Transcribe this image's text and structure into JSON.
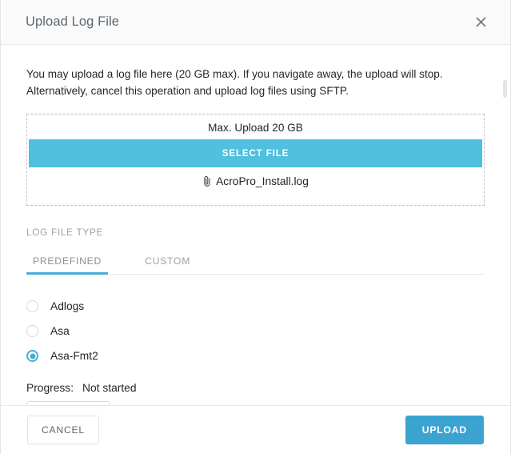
{
  "dialog": {
    "title": "Upload Log File",
    "close_icon": "close-icon"
  },
  "intro": {
    "line1": "You may upload a log file here (20 GB max). If you navigate away, the upload will stop.",
    "line2": "Alternatively, cancel this operation and upload log files using SFTP."
  },
  "dropzone": {
    "max_label": "Max. Upload 20 GB",
    "select_file_label": "SELECT FILE",
    "attachment_icon": "paperclip-icon",
    "file_name": "AcroPro_Install.log"
  },
  "log_file_type": {
    "section_label": "LOG FILE TYPE",
    "tabs": [
      {
        "label": "PREDEFINED",
        "active": true
      },
      {
        "label": "CUSTOM",
        "active": false
      }
    ],
    "options": [
      {
        "label": "Adlogs",
        "selected": false
      },
      {
        "label": "Asa",
        "selected": false
      },
      {
        "label": "Asa-Fmt2",
        "selected": true
      }
    ]
  },
  "progress": {
    "label": "Progress:",
    "status": "Not started",
    "percent": 0
  },
  "footer": {
    "cancel_label": "CANCEL",
    "upload_label": "UPLOAD"
  },
  "colors": {
    "accent": "#4aaed2",
    "select_file_blue": "#4fc0de",
    "upload_blue": "#3ba3d0"
  }
}
